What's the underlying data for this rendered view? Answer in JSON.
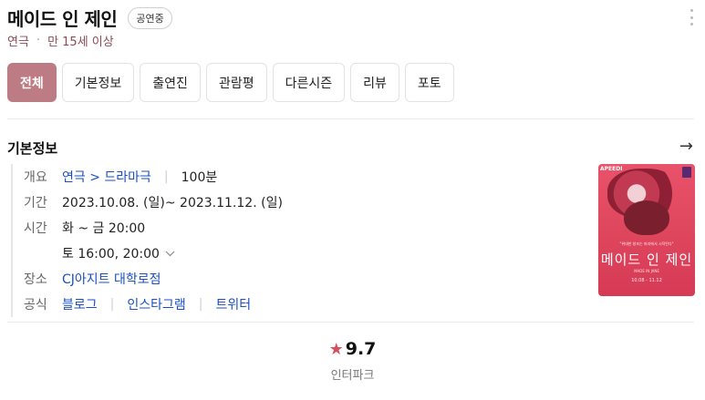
{
  "header": {
    "title": "메이드 인 제인",
    "badge": "공연중",
    "more_icon": "more-vertical-icon"
  },
  "subtitle": {
    "genre": "연극",
    "dot": "·",
    "age": "만 15세 이상"
  },
  "tabs": [
    {
      "label": "전체",
      "active": true
    },
    {
      "label": "기본정보"
    },
    {
      "label": "출연진"
    },
    {
      "label": "관람평"
    },
    {
      "label": "다른시즌"
    },
    {
      "label": "리뷰"
    },
    {
      "label": "포토"
    }
  ],
  "basic_info": {
    "title": "기본정보",
    "arrow_icon": "arrow-right-icon",
    "overview_label": "개요",
    "overview_link": "연극 > 드라마극",
    "overview_runtime": "100분",
    "period_label": "기간",
    "period_value": "2023.10.08. (일)~ 2023.11.12. (일)",
    "time_label": "시간",
    "time_value_1": "화 ~ 금 20:00",
    "time_value_2": "토 16:00, 20:00",
    "time_expand_icon": "chevron-down-icon",
    "venue_label": "장소",
    "venue_value": "CJ아지트 대학로점",
    "official_label": "공식",
    "official_links": [
      "블로그",
      "인스타그램",
      "트위터"
    ]
  },
  "poster": {
    "top_left_text": "APEEDI",
    "tagline": "\"위대한 창조는 파괴에서 시작된다\"",
    "title": "메이드 인 제인",
    "subtitle": "MADE IN JANE",
    "dates": "10.08 - 11.12"
  },
  "rating": {
    "star_icon": "star-icon",
    "score": "9.7",
    "source": "인터파크"
  },
  "colors": {
    "accent": "#bd7b84",
    "link": "#1a4fc4",
    "star": "#d4505c",
    "poster": "#e0485f"
  }
}
